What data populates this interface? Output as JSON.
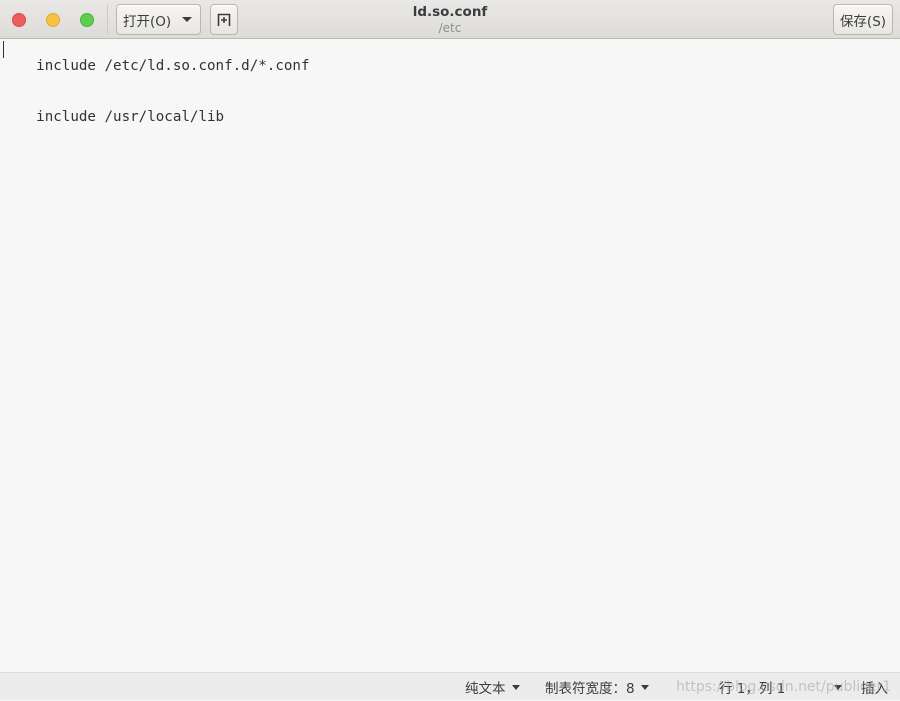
{
  "window": {
    "title": "ld.so.conf",
    "subtitle": "/etc"
  },
  "toolbar": {
    "open_label": "打开(O)",
    "new_tab_icon": "new-tab-icon",
    "save_label": "保存(S)"
  },
  "editor": {
    "lines": [
      "include /etc/ld.so.conf.d/*.conf",
      "include /usr/local/lib"
    ]
  },
  "statusbar": {
    "language": "纯文本",
    "tab_width": "制表符宽度：8",
    "position": "行 1，列 1",
    "mode": "插入",
    "watermark": "https://blog.csdn.net/publicer1"
  },
  "colors": {
    "close": "#ed5e5e",
    "minimize": "#f6c243",
    "maximize": "#5dcc4f"
  }
}
